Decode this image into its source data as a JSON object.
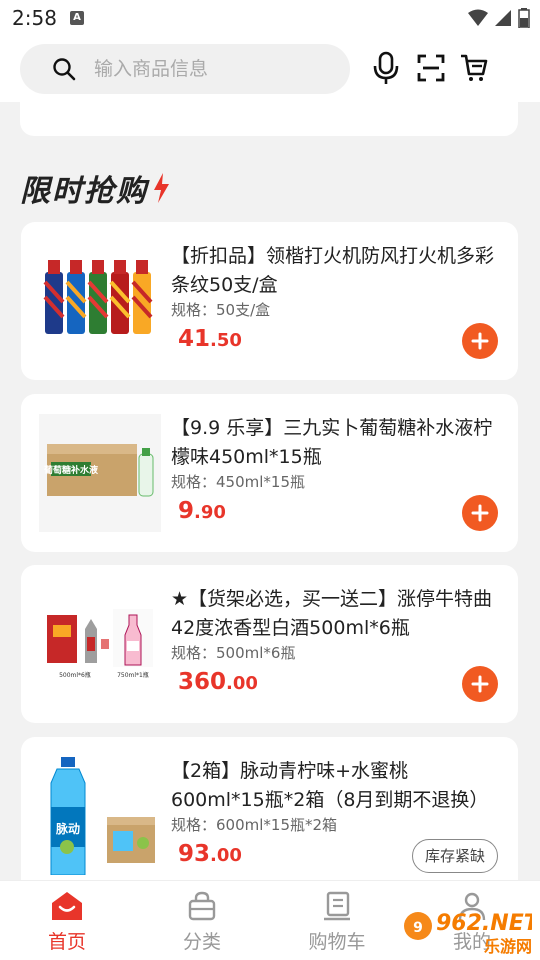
{
  "status_bar": {
    "time": "2:58",
    "notification_letter": "A",
    "icons": [
      "wifi-icon",
      "signal-icon",
      "battery-icon"
    ]
  },
  "search": {
    "placeholder": "输入商品信息",
    "icons": [
      "mic-icon",
      "scan-icon",
      "cart-icon"
    ]
  },
  "section": {
    "title": "限时抢购"
  },
  "products": [
    {
      "title": "【折扣品】领楷打火机防风打火机多彩条纹50支/盒",
      "spec": "规格：50支/盒",
      "price_int": "41",
      "price_dec": ".50",
      "action": "add"
    },
    {
      "title": "【9.9 乐享】三九实卜葡萄糖补水液柠檬味450ml*15瓶",
      "spec": "规格：450ml*15瓶",
      "price_int": "9",
      "price_dec": ".90",
      "action": "add",
      "image_text": "葡萄糖补水液"
    },
    {
      "title": "★【货架必选，买一送二】涨停牛特曲42度浓香型白酒500ml*6瓶",
      "spec": "规格：500ml*6瓶",
      "price_int": "360",
      "price_dec": ".00",
      "action": "add",
      "image_text_1": "500ml*6瓶",
      "image_text_2": "750ml*1瓶"
    },
    {
      "title": "【2箱】脉动青柠味+水蜜桃600ml*15瓶*2箱（8月到期不退换）",
      "spec": "规格：600ml*15瓶*2箱",
      "price_int": "93",
      "price_dec": ".00",
      "action": "stock",
      "stock_label": "库存紧缺",
      "image_text": "脉动"
    }
  ],
  "tabbar": {
    "tabs": [
      {
        "label": "首页",
        "icon": "home-icon",
        "active": true
      },
      {
        "label": "分类",
        "icon": "category-bag-icon",
        "active": false
      },
      {
        "label": "购物车",
        "icon": "cart-tab-icon",
        "active": false
      },
      {
        "label": "我的",
        "icon": "profile-icon",
        "active": false
      }
    ]
  },
  "watermark": {
    "brand": "962.NET",
    "sub": "乐游网"
  },
  "colors": {
    "accent": "#e8352a",
    "add_button": "#f15a22",
    "inactive_tab": "#999999"
  }
}
